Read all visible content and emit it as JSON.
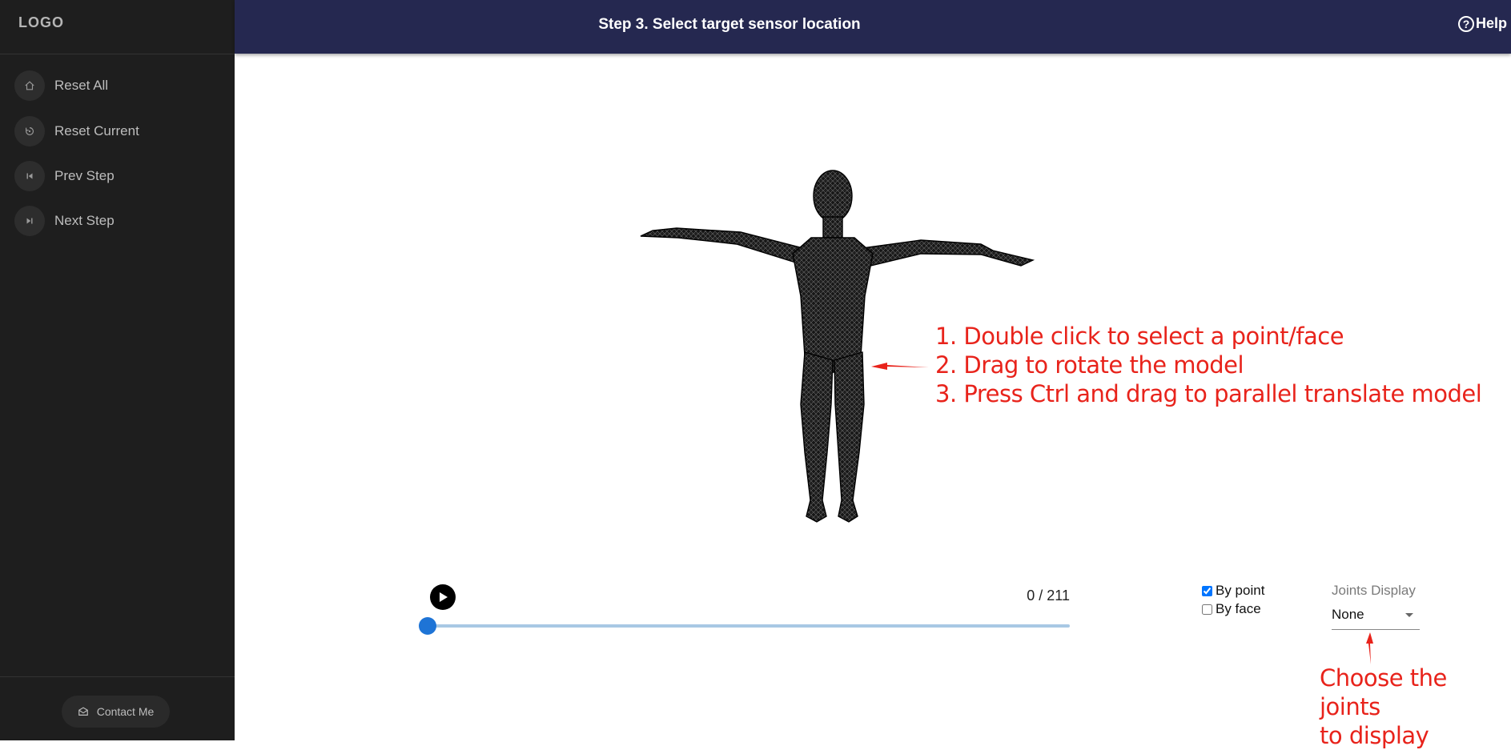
{
  "sidebar": {
    "logo": "LOGO",
    "items": [
      {
        "label": "Reset All",
        "icon": "home-icon"
      },
      {
        "label": "Reset Current",
        "icon": "reset-icon"
      },
      {
        "label": "Prev Step",
        "icon": "skip-previous-icon"
      },
      {
        "label": "Next Step",
        "icon": "skip-next-icon"
      }
    ],
    "contact_label": "Contact Me",
    "contact_icon": "mail-icon"
  },
  "header": {
    "title": "Step 3. Select target sensor location",
    "help_label": "Help",
    "help_icon": "help-circle-icon",
    "help_glyph": "?"
  },
  "annotations": {
    "instructions": [
      "1. Double click to select a point/face",
      "2. Drag to rotate the model",
      "3. Press Ctrl and drag to parallel translate model"
    ],
    "joints_note": [
      "Choose the joints",
      "to display"
    ]
  },
  "player": {
    "frame_counter": "0 / 211",
    "current_frame": 0,
    "total_frames": 211
  },
  "options": {
    "by_point_label": "By point",
    "by_point_checked": true,
    "by_face_label": "By face",
    "by_face_checked": false
  },
  "joints": {
    "label": "Joints Display",
    "value": "None"
  },
  "colors": {
    "sidebar_bg": "#1e1e1e",
    "header_bg": "#252850",
    "annotation_red": "#e8231b",
    "slider_blue": "#1e74d6"
  }
}
